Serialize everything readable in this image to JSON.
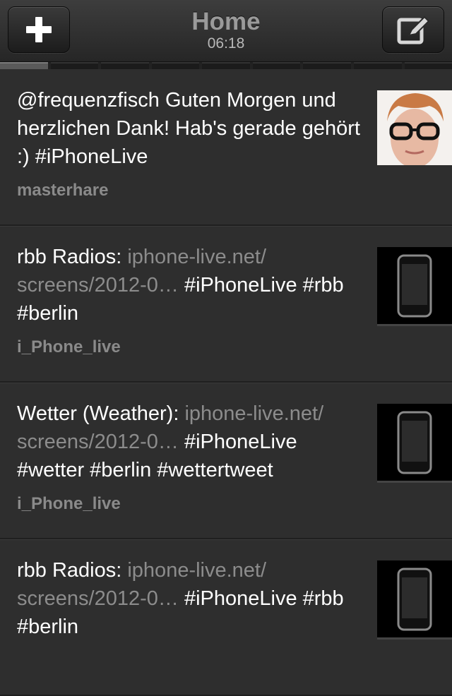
{
  "header": {
    "title": "Home",
    "time": "06:18",
    "left_icon": "plus-icon",
    "right_icon": "compose-icon"
  },
  "pager": {
    "segments": 9,
    "active_index": 0
  },
  "tweets": [
    {
      "parts": [
        "@frequenzfisch Guten Morgen und herzlichen Dank! Hab's gerade gehört :) #iPhoneLive"
      ],
      "username": "masterhare",
      "thumb": "avatar"
    },
    {
      "parts": [
        "rbb Radios: ",
        "iphone-live.net/ screens/2012-0…",
        " #iPhoneLive #rbb #berlin"
      ],
      "username": "i_Phone_live",
      "thumb": "iphone-icon"
    },
    {
      "parts": [
        "Wetter (Weather): ",
        "iphone-live.net/ screens/2012-0…",
        " #iPhoneLive #wetter #berlin #wettertweet"
      ],
      "username": "i_Phone_live",
      "thumb": "iphone-icon"
    },
    {
      "parts": [
        "rbb Radios: ",
        "iphone-live.net/ screens/2012-0…",
        " #iPhoneLive #rbb #berlin"
      ],
      "username": "",
      "thumb": "iphone-icon"
    }
  ]
}
